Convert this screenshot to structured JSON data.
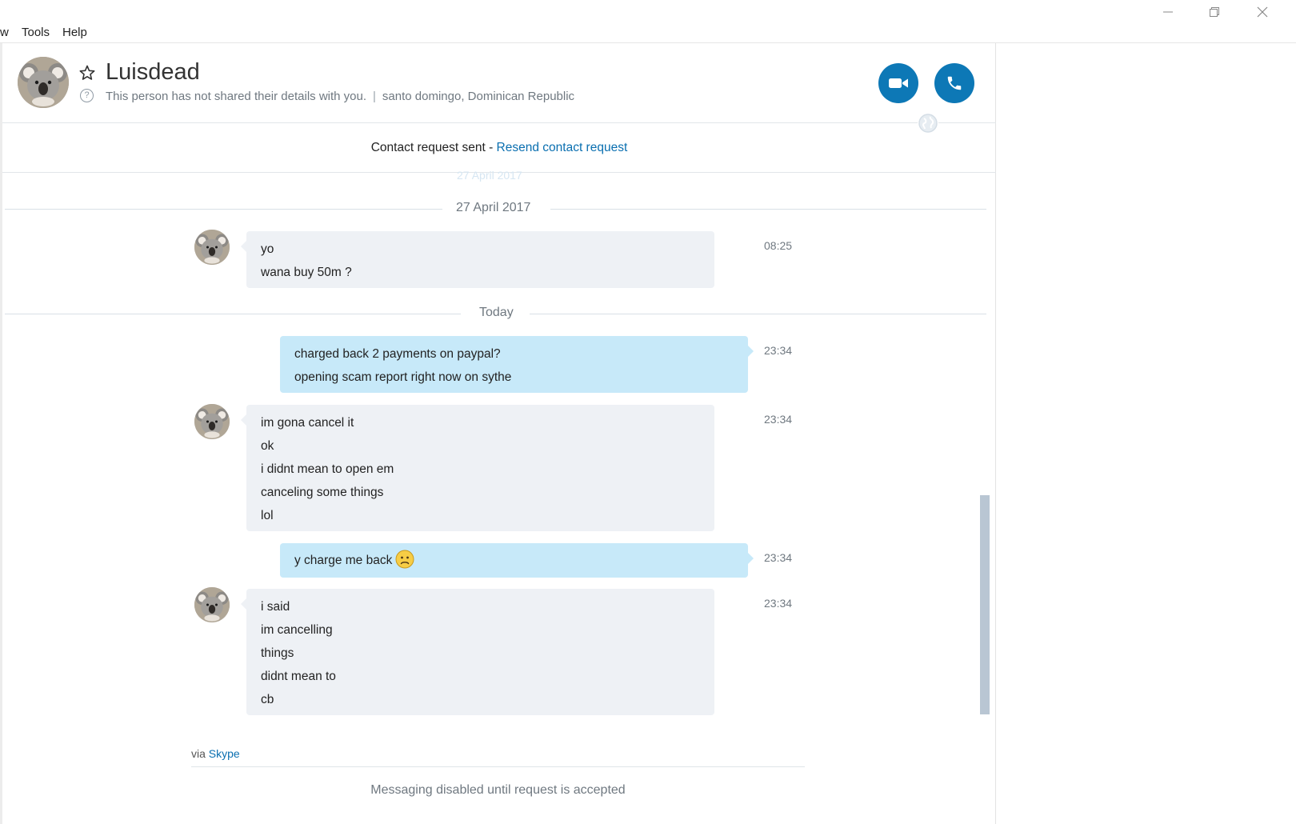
{
  "menu": {
    "items": [
      "w",
      "Tools",
      "Help"
    ]
  },
  "window": {
    "minimize_icon": "minimize-icon",
    "restore_icon": "restore-icon",
    "close_icon": "close-icon"
  },
  "header": {
    "name": "Luisdead",
    "details_text": "This person has not shared their details with you.",
    "separator": "|",
    "location": "santo domingo, Dominican Republic",
    "video_call_icon": "video-camera-icon",
    "audio_call_icon": "phone-icon"
  },
  "request_bar": {
    "text": "Contact request sent -",
    "link": "Resend contact request"
  },
  "faded_date": "27 April 2017",
  "conversation": {
    "date_1": "27 April 2017",
    "date_2": "Today",
    "messages": [
      {
        "from": "them",
        "lines": [
          "yo",
          "wana buy 50m ?"
        ],
        "time": "08:25"
      },
      {
        "from": "me",
        "lines": [
          "charged back 2 payments on paypal?",
          "opening scam report right now on sythe"
        ],
        "time": "23:34"
      },
      {
        "from": "them",
        "lines": [
          "im gona cancel it",
          "ok",
          "i didnt mean to open em",
          "canceling some things",
          "lol"
        ],
        "time": "23:34"
      },
      {
        "from": "me",
        "lines": [
          "y charge me back"
        ],
        "emoji": "sad-face-emoji",
        "time": "23:34"
      },
      {
        "from": "them",
        "lines": [
          "i said",
          "im cancelling",
          "things",
          "didnt mean to",
          "cb"
        ],
        "time": "23:34"
      }
    ]
  },
  "footer": {
    "via_prefix": "via",
    "via_link": "Skype",
    "disabled_text": "Messaging disabled until request is accepted"
  },
  "colors": {
    "accent": "#0d78b6",
    "link": "#0a6fb0",
    "incoming_bubble": "#eef1f5",
    "outgoing_bubble": "#c7e9f9"
  }
}
